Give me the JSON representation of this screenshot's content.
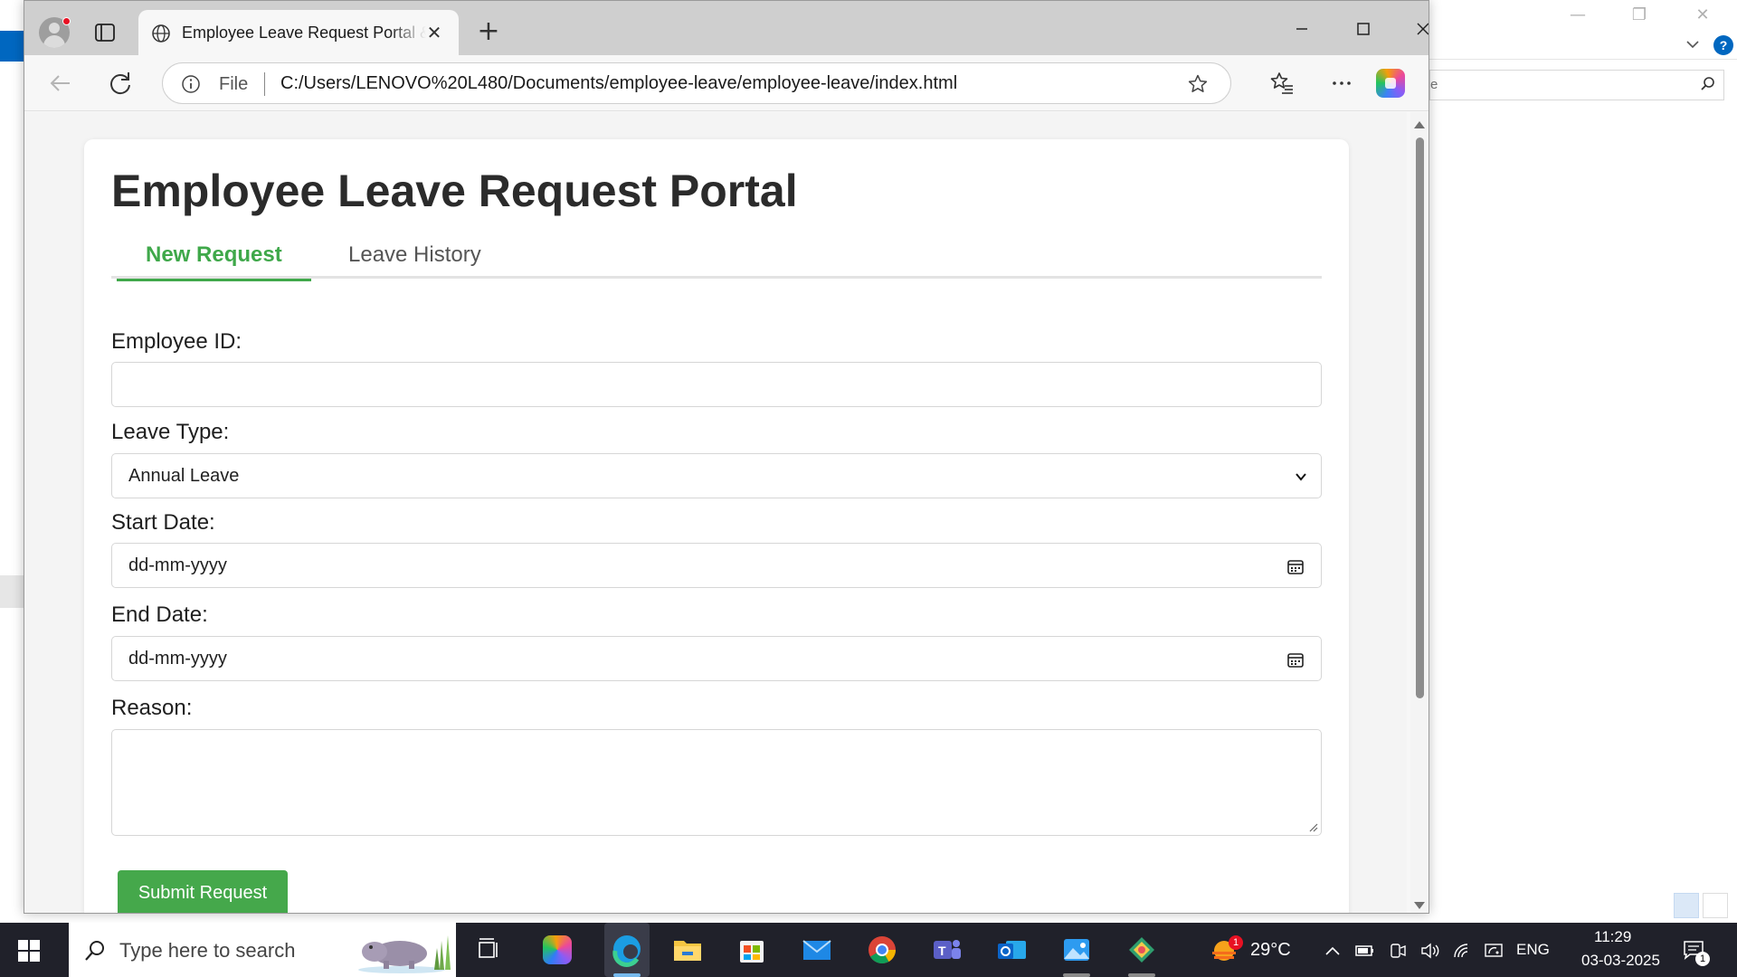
{
  "browser": {
    "tab_title": "Employee Leave Request Portal &",
    "address_prefix": "File",
    "url": "C:/Users/LENOVO%20L480/Documents/employee-leave/employee-leave/index.html"
  },
  "page": {
    "title": "Employee Leave Request Portal",
    "tabs": [
      {
        "label": "New Request",
        "active": true
      },
      {
        "label": "Leave History",
        "active": false
      }
    ],
    "form": {
      "employee_id": {
        "label": "Employee ID:",
        "value": ""
      },
      "leave_type": {
        "label": "Leave Type:",
        "selected": "Annual Leave"
      },
      "start_date": {
        "label": "Start Date:",
        "placeholder": "dd-mm-yyyy"
      },
      "end_date": {
        "label": "End Date:",
        "placeholder": "dd-mm-yyyy"
      },
      "reason": {
        "label": "Reason:",
        "value": ""
      },
      "submit_label": "Submit Request"
    }
  },
  "background_window": {
    "search_text": "e",
    "help_label": "?"
  },
  "taskbar": {
    "search_placeholder": "Type here to search",
    "weather_temp": "29°C",
    "weather_badge": "1",
    "language": "ENG",
    "time": "11:29",
    "date": "03-03-2025",
    "notification_count": "1"
  },
  "colors": {
    "accent_green": "#45a84b",
    "tab_active": "#3fa84a",
    "taskbar": "#20212a"
  }
}
